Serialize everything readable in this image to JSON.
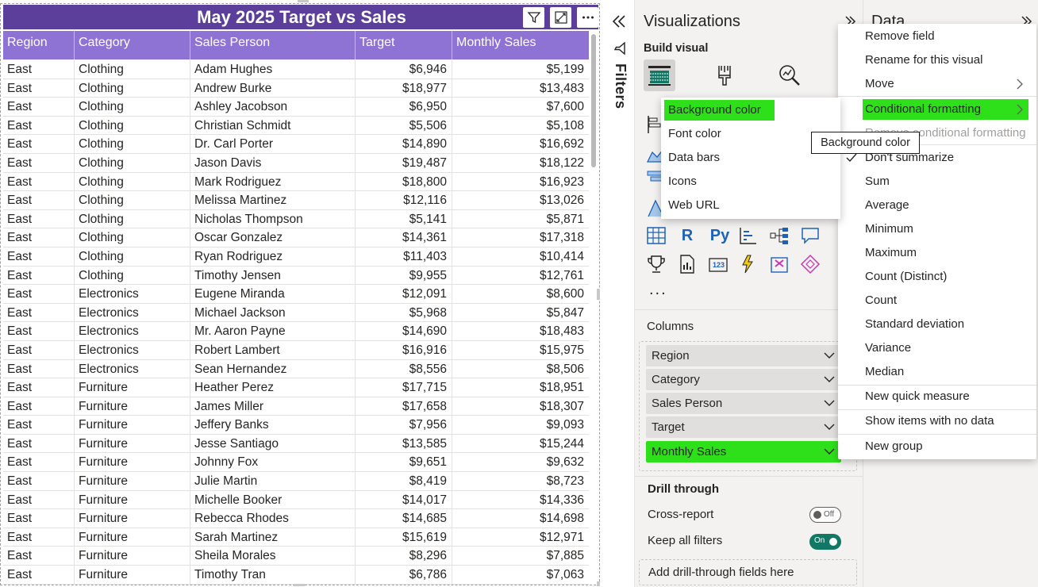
{
  "visual": {
    "title": "May 2025 Target vs Sales",
    "header_icons": [
      "filter-icon",
      "focus-mode-icon",
      "more-options-icon"
    ],
    "columns": [
      "Region",
      "Category",
      "Sales Person",
      "Target",
      "Monthly Sales"
    ],
    "rows": [
      [
        "East",
        "Clothing",
        "Adam Hughes",
        "$6,946",
        "$5,199"
      ],
      [
        "East",
        "Clothing",
        "Andrew Burke",
        "$18,977",
        "$13,483"
      ],
      [
        "East",
        "Clothing",
        "Ashley Jacobson",
        "$6,950",
        "$7,600"
      ],
      [
        "East",
        "Clothing",
        "Christian Schmidt",
        "$5,506",
        "$5,108"
      ],
      [
        "East",
        "Clothing",
        "Dr. Carl Porter",
        "$14,890",
        "$16,692"
      ],
      [
        "East",
        "Clothing",
        "Jason Davis",
        "$19,487",
        "$18,122"
      ],
      [
        "East",
        "Clothing",
        "Mark Rodriguez",
        "$18,800",
        "$16,923"
      ],
      [
        "East",
        "Clothing",
        "Melissa Martinez",
        "$12,116",
        "$13,026"
      ],
      [
        "East",
        "Clothing",
        "Nicholas Thompson",
        "$5,141",
        "$5,871"
      ],
      [
        "East",
        "Clothing",
        "Oscar Gonzalez",
        "$14,361",
        "$17,318"
      ],
      [
        "East",
        "Clothing",
        "Ryan Rodriguez",
        "$11,403",
        "$10,414"
      ],
      [
        "East",
        "Clothing",
        "Timothy Jensen",
        "$9,955",
        "$12,761"
      ],
      [
        "East",
        "Electronics",
        "Eugene Miranda",
        "$12,091",
        "$8,600"
      ],
      [
        "East",
        "Electronics",
        "Michael Jackson",
        "$5,968",
        "$5,847"
      ],
      [
        "East",
        "Electronics",
        "Mr. Aaron Payne",
        "$14,690",
        "$18,483"
      ],
      [
        "East",
        "Electronics",
        "Robert Lambert",
        "$16,916",
        "$15,975"
      ],
      [
        "East",
        "Electronics",
        "Sean Hernandez",
        "$8,556",
        "$8,506"
      ],
      [
        "East",
        "Furniture",
        "Heather Perez",
        "$17,715",
        "$18,951"
      ],
      [
        "East",
        "Furniture",
        "James Miller",
        "$17,658",
        "$18,307"
      ],
      [
        "East",
        "Furniture",
        "Jeffery Banks",
        "$7,956",
        "$9,093"
      ],
      [
        "East",
        "Furniture",
        "Jesse Santiago",
        "$13,585",
        "$15,244"
      ],
      [
        "East",
        "Furniture",
        "Johnny Fox",
        "$9,651",
        "$9,632"
      ],
      [
        "East",
        "Furniture",
        "Julie Martin",
        "$8,419",
        "$8,723"
      ],
      [
        "East",
        "Furniture",
        "Michelle Booker",
        "$14,017",
        "$14,336"
      ],
      [
        "East",
        "Furniture",
        "Rebecca Rhodes",
        "$14,685",
        "$14,698"
      ],
      [
        "East",
        "Furniture",
        "Sarah Martinez",
        "$15,619",
        "$12,971"
      ],
      [
        "East",
        "Furniture",
        "Sheila Morales",
        "$8,296",
        "$7,885"
      ],
      [
        "East",
        "Furniture",
        "Timothy Tran",
        "$6,786",
        "$7,063"
      ]
    ]
  },
  "filters_pane": {
    "label": "Filters"
  },
  "viz_pane": {
    "title": "Visualizations",
    "build_visual_label": "Build visual",
    "gallery_text_icons": {
      "r": "R",
      "py": "Py"
    },
    "gallery_more": "...",
    "columns_label": "Columns",
    "fields": [
      "Region",
      "Category",
      "Sales Person",
      "Target",
      "Monthly Sales"
    ],
    "drill_through": {
      "title": "Drill through",
      "cross_report_label": "Cross-report",
      "cross_report_state": "Off",
      "keep_filters_label": "Keep all filters",
      "keep_filters_state": "On",
      "drop_zone": "Add drill-through fields here"
    }
  },
  "data_pane": {
    "title": "Data"
  },
  "context_menu": {
    "remove_field": "Remove field",
    "rename": "Rename for this visual",
    "move": "Move",
    "conditional_formatting": "Conditional formatting",
    "remove_conditional_formatting": "Remove conditional formatting",
    "dont_summarize": "Don't summarize",
    "sum": "Sum",
    "average": "Average",
    "minimum": "Minimum",
    "maximum": "Maximum",
    "count_distinct": "Count (Distinct)",
    "count": "Count",
    "std_dev": "Standard deviation",
    "variance": "Variance",
    "median": "Median",
    "new_quick_measure": "New quick measure",
    "show_items_no_data": "Show items with no data",
    "new_group": "New group"
  },
  "submenu": {
    "background_color": "Background color",
    "font_color": "Font color",
    "data_bars": "Data bars",
    "icons": "Icons",
    "web_url": "Web URL"
  },
  "tooltip": {
    "text": "Background color"
  },
  "colors": {
    "title_bar": "#5c3f9b",
    "header_row": "#8f73d4",
    "highlight": "#2ee01a",
    "toggle_on": "#117865"
  }
}
